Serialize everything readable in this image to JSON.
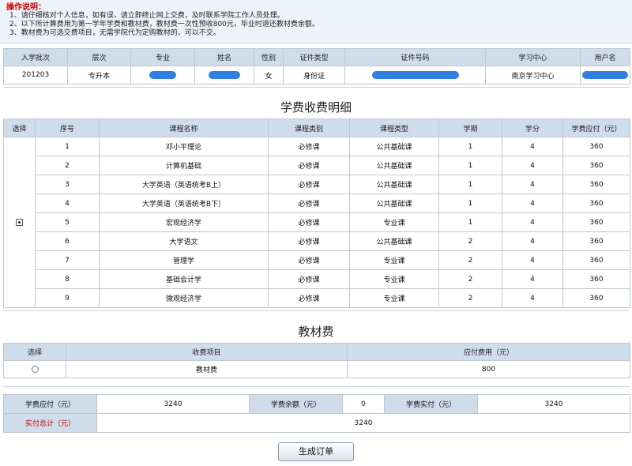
{
  "notice": {
    "title": "操作说明：",
    "lines": [
      "1、请仔细核对个人信息，如有误，请立即终止网上交费，及时联系学院工作人员处理。",
      "2、以下所计算费用为第一学年学费和教材费，教材费一次性预收800元，毕业时退还教材费余额。",
      "3、教材费为可选交费项目，无需学院代为定购教材的，可以不交。"
    ]
  },
  "student_info": {
    "headers": [
      "入学批次",
      "层次",
      "专业",
      "姓名",
      "性别",
      "证件类型",
      "证件号码",
      "学习中心",
      "用户名"
    ],
    "values": {
      "batch": "201203",
      "level": "专升本",
      "gender": "女",
      "id_type": "身份证",
      "center": "南京学习中心"
    },
    "redacted_color": "#2f7fe0"
  },
  "tuition": {
    "title": "学费收费明细",
    "headers": [
      "选择",
      "序号",
      "课程名称",
      "课程类别",
      "课程类型",
      "学期",
      "学分",
      "学费应付（元）"
    ],
    "rows": [
      [
        "1",
        "邓小平理论",
        "必修课",
        "公共基础课",
        "1",
        "4",
        "360"
      ],
      [
        "2",
        "计算机基础",
        "必修课",
        "公共基础课",
        "1",
        "4",
        "360"
      ],
      [
        "3",
        "大学英语（英语统考B上）",
        "必修课",
        "公共基础课",
        "1",
        "4",
        "360"
      ],
      [
        "4",
        "大学英语（英语统考B下）",
        "必修课",
        "公共基础课",
        "1",
        "4",
        "360"
      ],
      [
        "5",
        "宏观经济学",
        "必修课",
        "专业课",
        "1",
        "4",
        "360"
      ],
      [
        "6",
        "大学语文",
        "必修课",
        "公共基础课",
        "2",
        "4",
        "360"
      ],
      [
        "7",
        "管理学",
        "必修课",
        "专业课",
        "2",
        "4",
        "360"
      ],
      [
        "8",
        "基础会计学",
        "必修课",
        "专业课",
        "2",
        "4",
        "360"
      ],
      [
        "9",
        "微观经济学",
        "必修课",
        "专业课",
        "2",
        "4",
        "360"
      ]
    ],
    "selected": true
  },
  "textbook": {
    "title": "教材费",
    "headers": [
      "选择",
      "收费项目",
      "应付费用（元）"
    ],
    "item": "教材费",
    "amount": "800",
    "selected": false
  },
  "totals": {
    "due_label": "学费应付（元）",
    "due_value": "3240",
    "balance_label": "学费余额（元）",
    "balance_value": "0",
    "paid_label": "学费实付（元）",
    "paid_value": "3240",
    "grand_label": "实付总计（元）",
    "grand_value": "3240",
    "accent_red": "#cc0000"
  },
  "actions": {
    "generate_label": "生成订单"
  }
}
